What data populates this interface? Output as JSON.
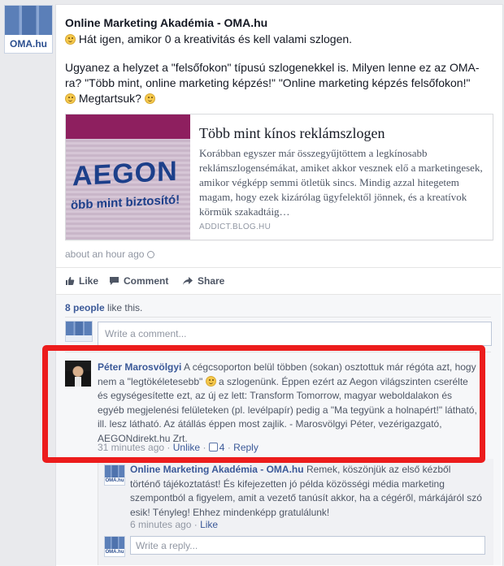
{
  "post": {
    "author": "Online Marketing Akadémia - OMA.hu",
    "avatar_logo": "OMA.hu",
    "line1": "Hát igen, amikor 0 a kreativitás és kell valami szlogen.",
    "line2a": "Ugyanez a helyzet a \"felsőfokon\" típusú szlogenekkel is. Milyen lenne ez az OMA-ra? \"Több mint, online marketing képzés!\" \"Online marketing képzés felsőfokon!\"",
    "line2b": "Megtartsuk?",
    "timestamp": "about an hour ago"
  },
  "link_preview": {
    "title": "Több mint kínos reklámszlogen",
    "description": "Korábban egyszer már összegyűjtöttem a legkínosabb reklámszlogensémákat, amiket akkor vesznek elő a marketingesek, amikor végképp semmi ötletük sincs. Mindig azzal hitegetem magam, hogy ezek kizárólag ügyfelektől jönnek, és a kreatívok körmük szakadtáig…",
    "domain": "ADDICT.BLOG.HU",
    "thumb_brand": "AEGON",
    "thumb_tagline": "öbb mint biztosító!"
  },
  "actions": {
    "like": "Like",
    "comment": "Comment",
    "share": "Share"
  },
  "likes": {
    "count": "8 people",
    "suffix": "like this."
  },
  "comment_input": {
    "placeholder": "Write a comment..."
  },
  "comment": {
    "author": "Péter Marosvölgyi",
    "text1": "A cégcsoporton belül többen (sokan) osztottuk már régóta azt, hogy nem a \"legtökéletesebb\"",
    "text2": "a szlogenünk. Éppen ezért az Aegon világszinten cserélte és egységesítette ezt, az új ez lett: Transform Tomorrow, magyar weboldalakon és egyéb megjelenési felületeken (pl. levélpapír) pedig a \"Ma tegyünk a holnapért!\" látható, ill. lesz látható. Az átállás éppen most zajlik. - Marosvölgyi Péter, vezérigazgató, AEGONdirekt.hu Zrt.",
    "time": "31 minutes ago",
    "sep": "·",
    "unlike": "Unlike",
    "like_count": "4",
    "reply": "Reply"
  },
  "reply": {
    "author": "Online Marketing Akadémia - OMA.hu",
    "text": "Remek, köszönjük az első kézből történő tájékoztatást! És kifejezetten jó példa közösségi média marketing szempontból a figyelem, amit a vezető tanúsít akkor, ha a cégéről, márkájáról szó esik! Tényleg! Ehhez mindenképp gratulálunk!",
    "time": "6 minutes ago",
    "sep": "·",
    "like": "Like"
  },
  "reply_input": {
    "placeholder": "Write a reply..."
  },
  "colors": {
    "link_blue": "#3b5998",
    "highlight_red": "#ec1c1c",
    "text_gray": "#4e5665"
  }
}
